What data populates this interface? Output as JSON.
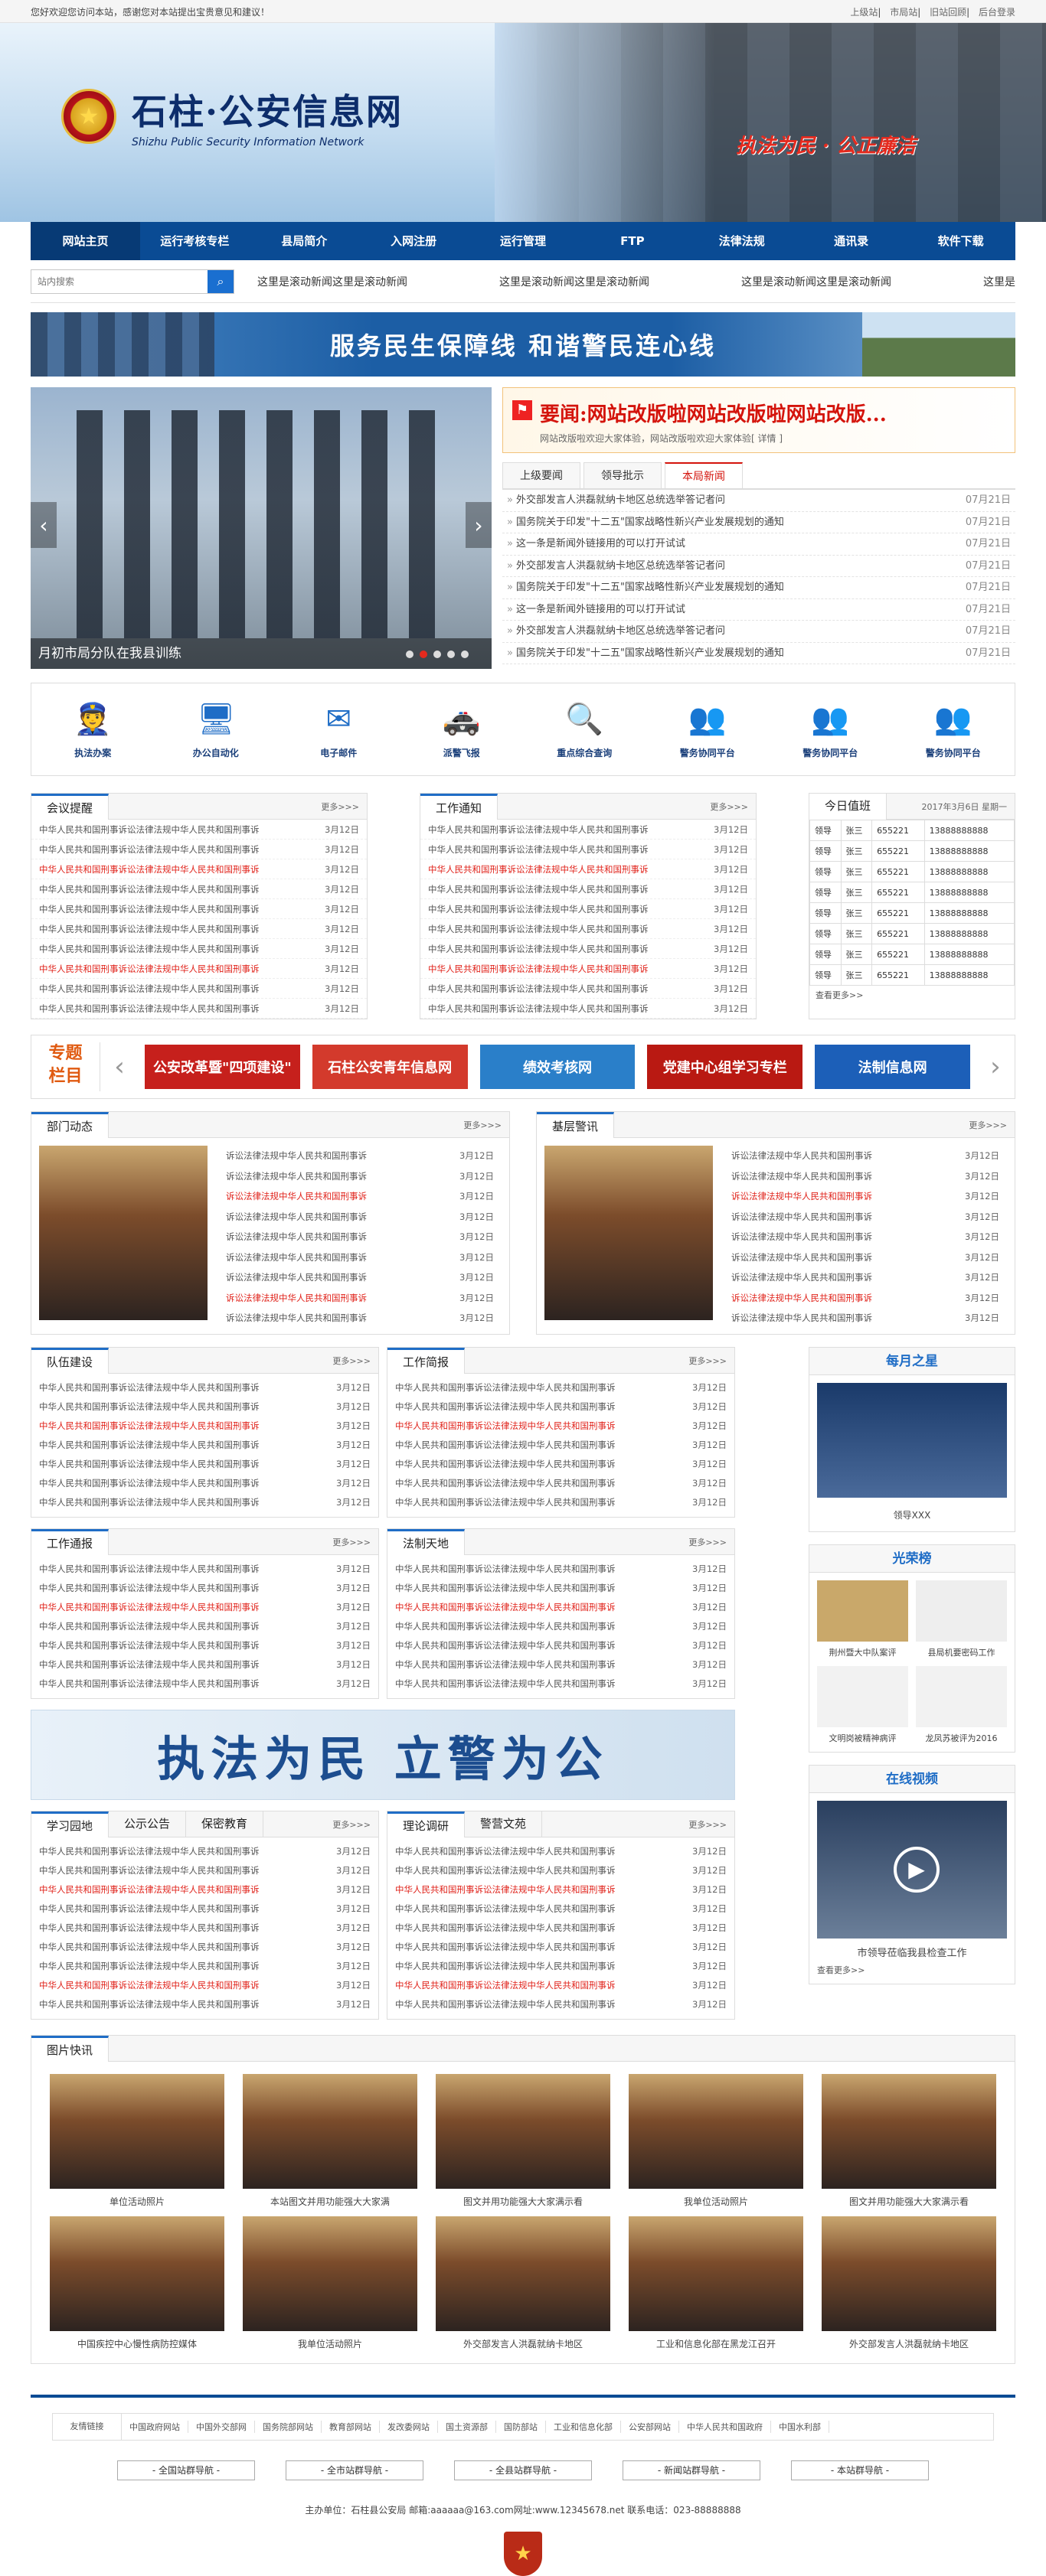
{
  "topbar": {
    "welcome": "您好欢迎您访问本站，感谢您对本站提出宝贵意见和建议！",
    "links": [
      "上级站",
      "市局站",
      "旧站回顾",
      "后台登录"
    ]
  },
  "header": {
    "title": "石柱·公安信息网",
    "subtitle": "Shizhu Public Security Information Network",
    "slogan": "执法为民 · 公正廉洁"
  },
  "nav": [
    "网站主页",
    "运行考核专栏",
    "县局简介",
    "入网注册",
    "运行管理",
    "FTP",
    "法律法规",
    "通讯录",
    "软件下载"
  ],
  "search": {
    "placeholder": "站内搜索",
    "marquee": [
      "这里是滚动新闻这里是滚动新闻",
      "这里是滚动新闻这里是滚动新闻",
      "这里是滚动新闻这里是滚动新闻",
      "这里是"
    ]
  },
  "banner1": "服务民生保障线    和谐警民连心线",
  "slider": {
    "caption": "月初市局分队在我县训练"
  },
  "headline": {
    "title": "要闻:网站改版啦网站改版啦网站改版...",
    "sub": "网站改版啦欢迎大家体验，网站改版啦欢迎大家体验[ 详情 ]"
  },
  "news_tabs": [
    "上级要闻",
    "领导批示",
    "本局新闻"
  ],
  "news": [
    {
      "t": "外交部发言人洪磊就纳卡地区总统选举答记者问",
      "d": "07月21日"
    },
    {
      "t": "国务院关于印发\"十二五\"国家战略性新兴产业发展规划的通知",
      "d": "07月21日"
    },
    {
      "t": "这一条是新闻外链接用的可以打开试试",
      "d": "07月21日"
    },
    {
      "t": "外交部发言人洪磊就纳卡地区总统选举答记者问",
      "d": "07月21日"
    },
    {
      "t": "国务院关于印发\"十二五\"国家战略性新兴产业发展规划的通知",
      "d": "07月21日"
    },
    {
      "t": "这一条是新闻外链接用的可以打开试试",
      "d": "07月21日"
    },
    {
      "t": "外交部发言人洪磊就纳卡地区总统选举答记者问",
      "d": "07月21日"
    },
    {
      "t": "国务院关于印发\"十二五\"国家战略性新兴产业发展规划的通知",
      "d": "07月21日"
    }
  ],
  "services": [
    "执法办案",
    "办公自动化",
    "电子邮件",
    "派警飞报",
    "重点综合查询",
    "警务协同平台",
    "警务协同平台",
    "警务协同平台"
  ],
  "more": "更多>>>",
  "item": "中华人民共和国刑事诉讼法律法规中华人民共和国刑事诉",
  "itemShort": "诉讼法律法规中华人民共和国刑事诉",
  "date": "3月12日",
  "meeting": {
    "title": "会议提醒"
  },
  "notice": {
    "title": "工作通知"
  },
  "duty": {
    "title": "今日值班",
    "date": "2017年3月6日 星期一",
    "rows": [
      [
        "领导",
        "张三",
        "655221",
        "13888888888"
      ],
      [
        "领导",
        "张三",
        "655221",
        "13888888888"
      ],
      [
        "领导",
        "张三",
        "655221",
        "13888888888"
      ],
      [
        "领导",
        "张三",
        "655221",
        "13888888888"
      ],
      [
        "领导",
        "张三",
        "655221",
        "13888888888"
      ],
      [
        "领导",
        "张三",
        "655221",
        "13888888888"
      ],
      [
        "领导",
        "张三",
        "655221",
        "13888888888"
      ],
      [
        "领导",
        "张三",
        "655221",
        "13888888888"
      ]
    ],
    "more": "查看更多>>"
  },
  "topics": {
    "label1": "专题",
    "label2": "栏目",
    "items": [
      "公安改革暨\"四项建设\"",
      "石柱公安青年信息网",
      "绩效考核网",
      "党建中心组学习专栏",
      "法制信息网"
    ]
  },
  "dept": {
    "title": "部门动态"
  },
  "base": {
    "title": "基层警讯"
  },
  "team": {
    "title": "队伍建设"
  },
  "brief": {
    "title": "工作简报"
  },
  "report": {
    "title": "工作通报"
  },
  "law": {
    "title": "法制天地"
  },
  "star": {
    "title": "每月之星",
    "name": "领导XXX"
  },
  "honor": {
    "title": "光荣榜",
    "items": [
      "荆州暨大中队案评",
      "县局机要密码工作",
      "文明岗被精神病评",
      "龙凤苏被评为2016"
    ]
  },
  "bigbanner": "执法为民  立警为公",
  "study": {
    "tabs": [
      "学习园地",
      "公示公告",
      "保密教育"
    ]
  },
  "research": {
    "tabs": [
      "理论调研",
      "警营文苑"
    ]
  },
  "video": {
    "title": "在线视频",
    "caption": "市领导莅临我县检查工作",
    "more": "查看更多>>"
  },
  "gallery": {
    "title": "图片快讯",
    "captions": [
      "单位活动照片",
      "本站图文并用功能强大大家满",
      "图文并用功能强大大家满示看",
      "我单位活动照片",
      "图文并用功能强大大家满示看",
      "中国疾控中心慢性病防控媒体",
      "我单位活动照片",
      "外交部发言人洪磊就纳卡地区",
      "工业和信息化部在黑龙江召开",
      "外交部发言人洪磊就纳卡地区"
    ]
  },
  "friend": {
    "label": "友情链接",
    "links": [
      "中国政府网站",
      "中国外交部网",
      "国务院部网站",
      "教育部网站",
      "发改委网站",
      "国土资源部",
      "国防部站",
      "工业和信息化部",
      "公安部网站",
      "中华人民共和国政府",
      "中国水利部"
    ]
  },
  "selects": [
    "- 全国站群导航 -",
    "- 全市站群导航 -",
    "- 全县站群导航 -",
    "- 新闻站群导航 -",
    "- 本站群导航 -"
  ],
  "footer": {
    "info": "主办单位：石柱县公安局   邮箱:aaaaaa@163.com网址:www.12345678.net   联系电话：023-88888888"
  },
  "colors": {
    "nav": "#0a4b94",
    "accent": "#1f6dc6",
    "red": "#e0231b"
  }
}
